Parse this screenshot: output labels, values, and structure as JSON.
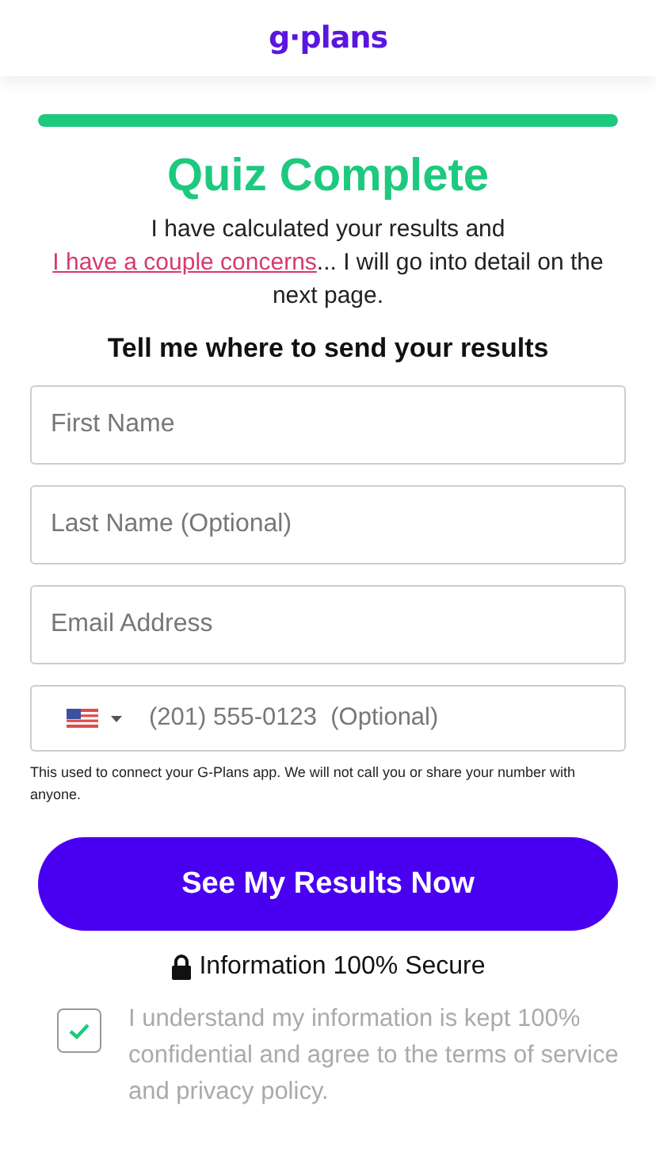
{
  "logo": "g·plans",
  "progress": {
    "level": 1
  },
  "title": "Quiz Complete",
  "intro": {
    "before": "I have calculated your results and ",
    "link": "I have a couple concerns",
    "after": "... I will go into detail on the next page."
  },
  "form_heading": "Tell me where to send your results",
  "fields": [
    {
      "kind": "text",
      "placeholder": "First Name"
    },
    {
      "kind": "text",
      "placeholder": "Last Name (Optional)"
    },
    {
      "kind": "text",
      "placeholder": "Email Address"
    },
    {
      "kind": "phone",
      "placeholder": "(201) 555-0123  (Optional)"
    }
  ],
  "phone_note": "This used to connect your G-Plans app. We will not call you or share your number with anyone.",
  "submit": "See My Results Now",
  "secure": "Information 100% Secure",
  "consent": {
    "checked": true,
    "text": "I understand my information is kept 100% confidential and agree to the terms of service and privacy policy."
  }
}
